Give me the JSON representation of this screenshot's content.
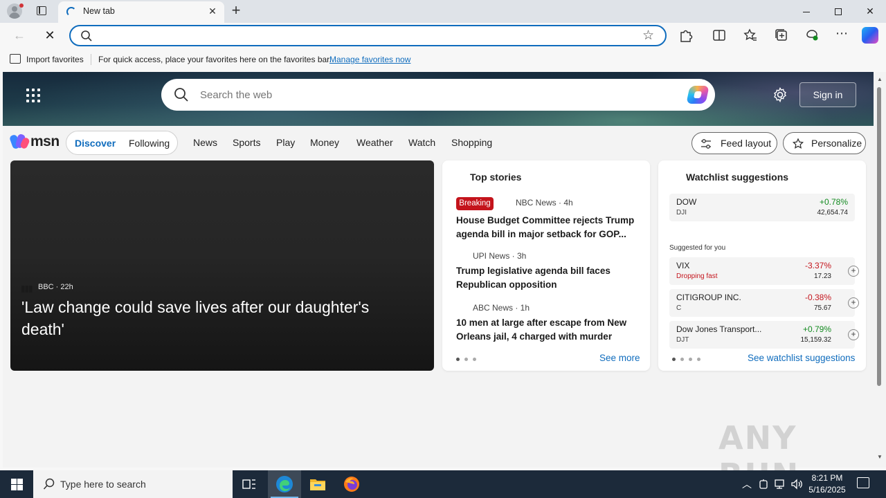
{
  "browser": {
    "tab_title": "New tab",
    "address_value": "",
    "favorites_bar": {
      "import_label": "Import favorites",
      "message": "For quick access, place your favorites here on the favorites bar.",
      "manage_link": "Manage favorites now"
    }
  },
  "msn": {
    "search_placeholder": "Search the web",
    "sign_in": "Sign in",
    "logo_text": "msn",
    "feed_tabs": [
      {
        "label": "Discover",
        "active": true
      },
      {
        "label": "Following",
        "active": false
      }
    ],
    "nav": [
      "News",
      "Sports",
      "Play",
      "Money",
      "Weather",
      "Watch",
      "Shopping"
    ],
    "feed_layout": "Feed layout",
    "personalize": "Personalize"
  },
  "hero": {
    "source": "BBC · 22h",
    "title": "'Law change could save lives after our daughter's death'"
  },
  "top_stories": {
    "heading": "Top stories",
    "breaking_label": "Breaking",
    "items": [
      {
        "source": "NBC News · 4h",
        "title": "House Budget Committee rejects Trump agenda bill in major setback for GOP..."
      },
      {
        "source": "UPI News · 3h",
        "title": "Trump legislative agenda bill faces Republican opposition"
      },
      {
        "source": "ABC News · 1h",
        "title": "10 men at large after escape from New Orleans jail, 4 charged with murder"
      }
    ],
    "see_more": "See more"
  },
  "watchlist": {
    "heading": "Watchlist suggestions",
    "top": {
      "name": "DOW",
      "symbol": "DJI",
      "change": "+0.78%",
      "value": "42,654.74"
    },
    "suggested_label": "Suggested for you",
    "items": [
      {
        "name": "VIX",
        "symbol": "Dropping fast",
        "change": "-3.37%",
        "value": "17.23"
      },
      {
        "name": "CITIGROUP INC.",
        "symbol": "C",
        "change": "-0.38%",
        "value": "75.67"
      },
      {
        "name": "Dow Jones Transport...",
        "symbol": "DJT",
        "change": "+0.79%",
        "value": "15,159.32"
      }
    ],
    "see_link": "See watchlist suggestions"
  },
  "watermark": "ANY RUN",
  "taskbar": {
    "search_placeholder": "Type here to search",
    "time": "8:21 PM",
    "date": "5/16/2025"
  },
  "colors": {
    "accent": "#0f6cbd",
    "up": "#138a20",
    "down": "#c4141c",
    "taskbar": "#1c2a3a"
  }
}
